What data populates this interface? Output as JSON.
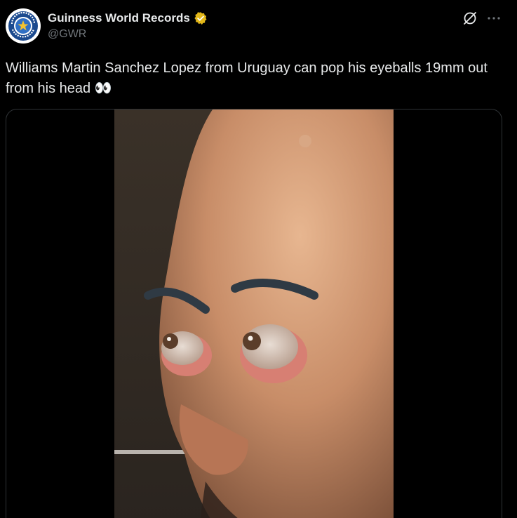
{
  "tweet": {
    "display_name": "Guinness World Records",
    "handle": "@GWR",
    "text": "Williams Martin Sanchez Lopez from Uruguay can pop his eyeballs 19mm out from his head",
    "emoji": "👀"
  },
  "icons": {
    "verified": "gold-verified-badge-icon",
    "grok": "grok-icon",
    "more": "more-options-icon"
  },
  "colors": {
    "background": "#000000",
    "text_primary": "#e7e9ea",
    "text_secondary": "#71767b",
    "verified_gold": "#e2b719",
    "border": "#2f3336"
  }
}
